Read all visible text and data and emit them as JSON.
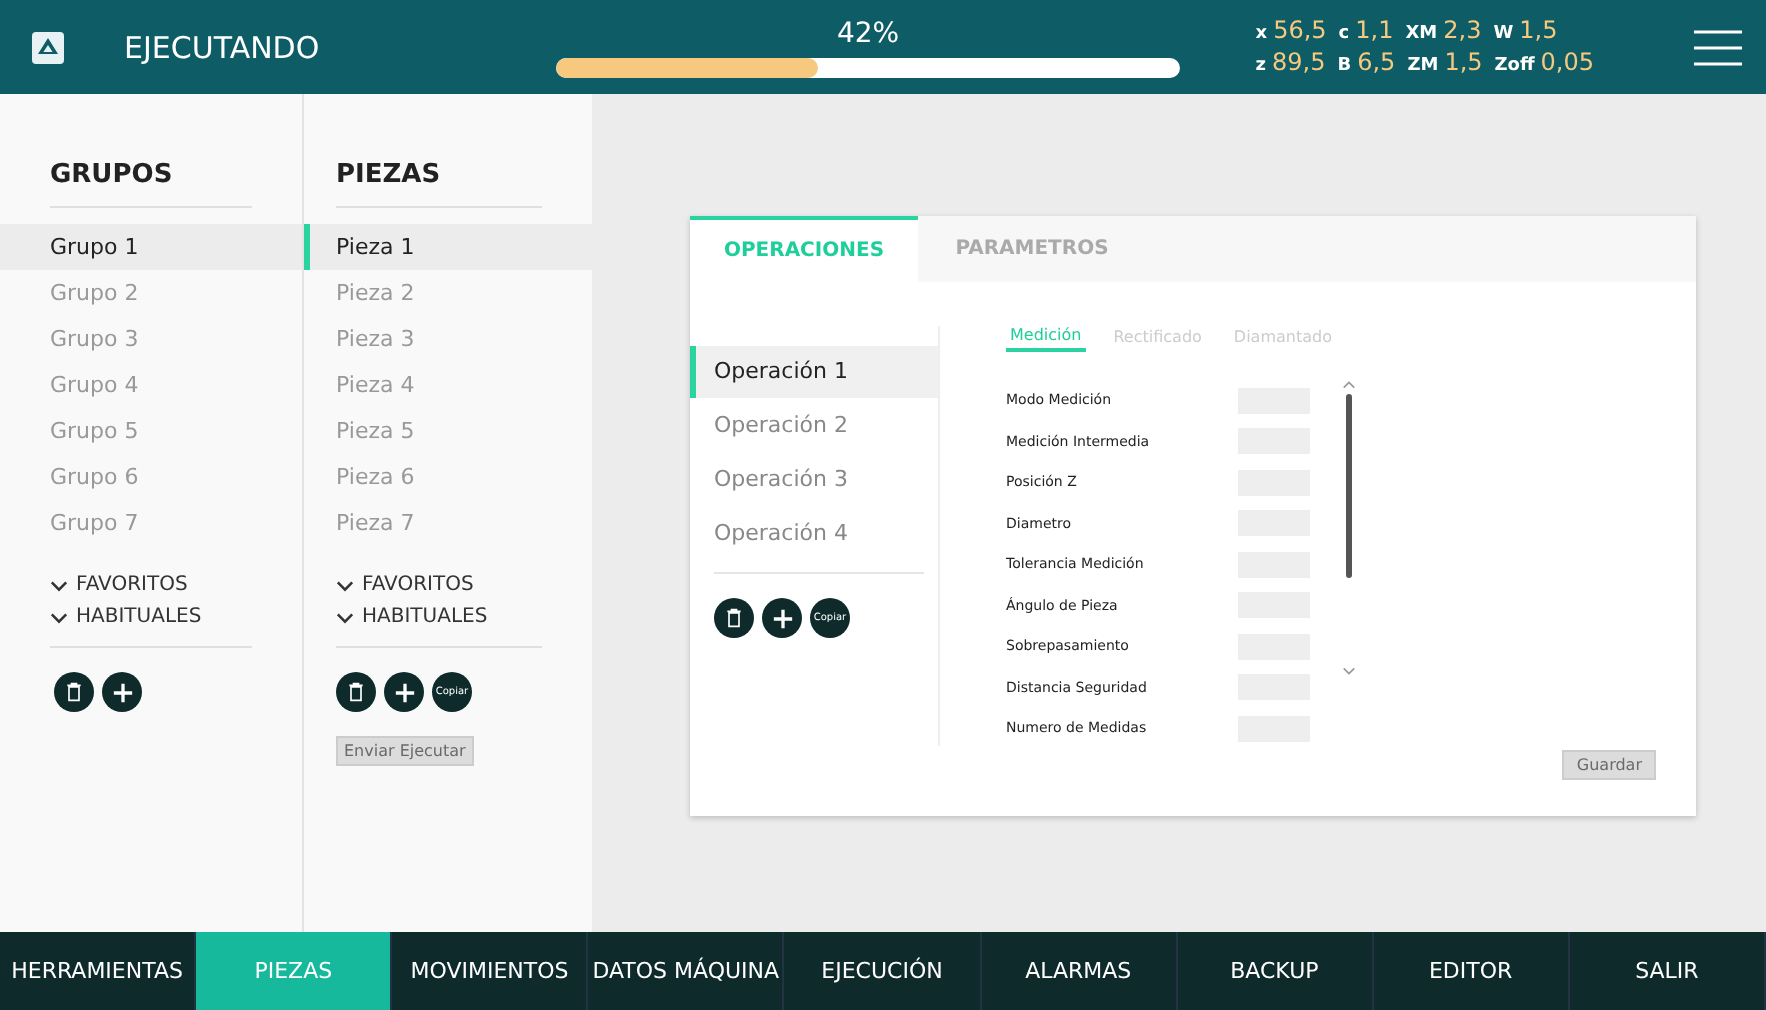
{
  "top_bar": {
    "status": "EJECUTANDO",
    "progress": {
      "reading": "42%",
      "level": 0.42
    },
    "readings": [
      [
        {
          "label": "x",
          "value": "56,5"
        },
        {
          "label": "c",
          "value": "1,1"
        },
        {
          "label": "XM",
          "value": "2,3"
        },
        {
          "label": "W",
          "value": "1,5"
        }
      ],
      [
        {
          "label": "z",
          "value": "89,5"
        },
        {
          "label": "B",
          "value": "6,5"
        },
        {
          "label": "ZM",
          "value": "1,5"
        },
        {
          "label": "Zoff",
          "value": "0,05"
        }
      ]
    ]
  },
  "groups": {
    "title": "GRUPOS",
    "items": [
      {
        "label": "Grupo 1",
        "selected": true
      },
      {
        "label": "Grupo 2",
        "selected": false
      },
      {
        "label": "Grupo 3",
        "selected": false
      },
      {
        "label": "Grupo 4",
        "selected": false
      },
      {
        "label": "Grupo 5",
        "selected": false
      },
      {
        "label": "Grupo 6",
        "selected": false
      },
      {
        "label": "Grupo 7",
        "selected": false
      }
    ],
    "sections": [
      "FAVORITOS",
      "HABITUALES"
    ],
    "buttons": [
      {
        "kind": "delete"
      },
      {
        "kind": "add"
      }
    ]
  },
  "pieces": {
    "title": "PIEZAS",
    "items": [
      {
        "label": "Pieza 1",
        "selected": true
      },
      {
        "label": "Pieza 2",
        "selected": false
      },
      {
        "label": "Pieza 3",
        "selected": false
      },
      {
        "label": "Pieza 4",
        "selected": false
      },
      {
        "label": "Pieza 5",
        "selected": false
      },
      {
        "label": "Pieza 6",
        "selected": false
      },
      {
        "label": "Pieza 7",
        "selected": false
      }
    ],
    "sections": [
      "FAVORITOS",
      "HABITUALES"
    ],
    "buttons": [
      {
        "kind": "delete"
      },
      {
        "kind": "add"
      },
      {
        "kind": "copy",
        "label": "Copiar"
      }
    ],
    "send_button": {
      "label": "Enviar Ejecutar",
      "disabled": true
    }
  },
  "card": {
    "tabs": [
      {
        "label": "OPERACIONES",
        "selected": true
      },
      {
        "label": "PARAMETROS",
        "selected": false
      }
    ],
    "operations": [
      {
        "label": "Operación 1",
        "selected": true
      },
      {
        "label": "Operación 2",
        "selected": false
      },
      {
        "label": "Operación 3",
        "selected": false
      },
      {
        "label": "Operación 4",
        "selected": false
      }
    ],
    "buttons": [
      {
        "kind": "delete"
      },
      {
        "kind": "add"
      },
      {
        "kind": "copy",
        "label": "Copiar"
      }
    ],
    "subtabs": [
      {
        "label": "Medición",
        "selected": true
      },
      {
        "label": "Rectificado",
        "selected": false
      },
      {
        "label": "Diamantado",
        "selected": false
      }
    ],
    "fields": [
      "Modo Medición",
      "Medición Intermedia",
      "Posición Z",
      "Diametro",
      "Tolerancia Medición",
      "Ángulo de Pieza",
      "Sobrepasamiento",
      "Distancia Seguridad",
      "Numero de Medidas"
    ],
    "save_button": {
      "label": "Guardar",
      "disabled": true
    }
  },
  "nav": [
    {
      "label": "HERRAMIENTAS",
      "selected": false
    },
    {
      "label": "PIEZAS",
      "selected": true
    },
    {
      "label": "MOVIMIENTOS",
      "selected": false
    },
    {
      "label": "DATOS MÁQUINA",
      "selected": false
    },
    {
      "label": "EJECUCIÓN",
      "selected": false
    },
    {
      "label": "ALARMAS",
      "selected": false
    },
    {
      "label": "BACKUP",
      "selected": false
    },
    {
      "label": "EDITOR",
      "selected": false
    },
    {
      "label": "SALIR",
      "selected": false
    }
  ]
}
